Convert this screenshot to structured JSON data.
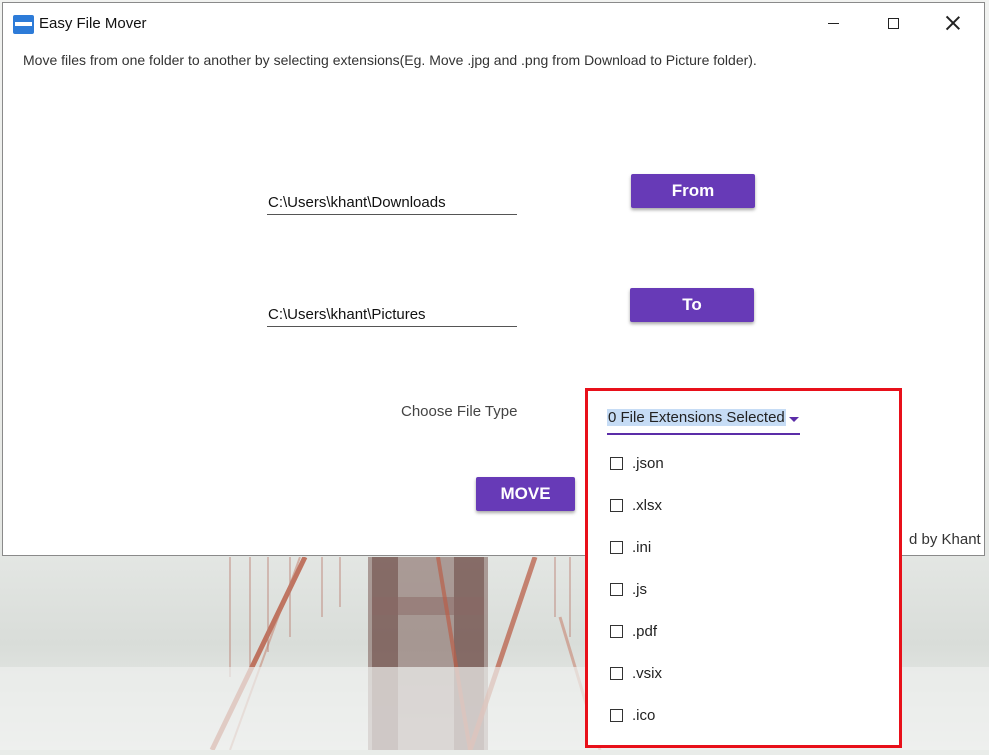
{
  "window": {
    "title": "Easy File Mover",
    "controls": [
      "minimize-icon",
      "maximize-icon",
      "close-icon"
    ]
  },
  "description": "Move files from one folder to another by selecting extensions(Eg. Move  .jpg and .png from Download to Picture folder).",
  "from": {
    "path": "C:\\Users\\khant\\Downloads",
    "button_label": "From"
  },
  "to": {
    "path": "C:\\Users\\khant\\Pictures",
    "button_label": "To"
  },
  "file_type": {
    "label": "Choose File Type",
    "selected_text": "0 File Extensions Selected",
    "options": [
      ".json",
      ".xlsx",
      ".ini",
      ".js",
      ".pdf",
      ".vsix",
      ".ico"
    ]
  },
  "move_label": "MOVE",
  "credit_fragment": "d by Khant",
  "colors": {
    "accent": "#673ab7",
    "highlight": "#e8101a",
    "selection": "#c6dcf5"
  }
}
